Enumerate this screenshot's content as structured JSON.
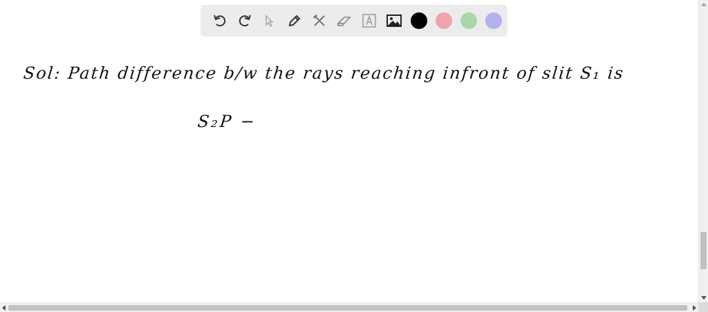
{
  "toolbar": {
    "tools": [
      {
        "icon": "undo-icon"
      },
      {
        "icon": "redo-icon"
      },
      {
        "icon": "select-arrow-icon"
      },
      {
        "icon": "pen-icon"
      },
      {
        "icon": "tools-icon"
      },
      {
        "icon": "eraser-icon"
      },
      {
        "icon": "text-box-icon",
        "glyph": "A"
      },
      {
        "icon": "image-icon"
      }
    ],
    "colors": [
      "#000000",
      "#f0a3ab",
      "#a7d8a8",
      "#b4b1f0"
    ]
  },
  "canvas": {
    "handwriting_line1": "Sol: Path difference b/w the rays reaching infront of slit S₁ is",
    "handwriting_line2": "S₂P −"
  }
}
